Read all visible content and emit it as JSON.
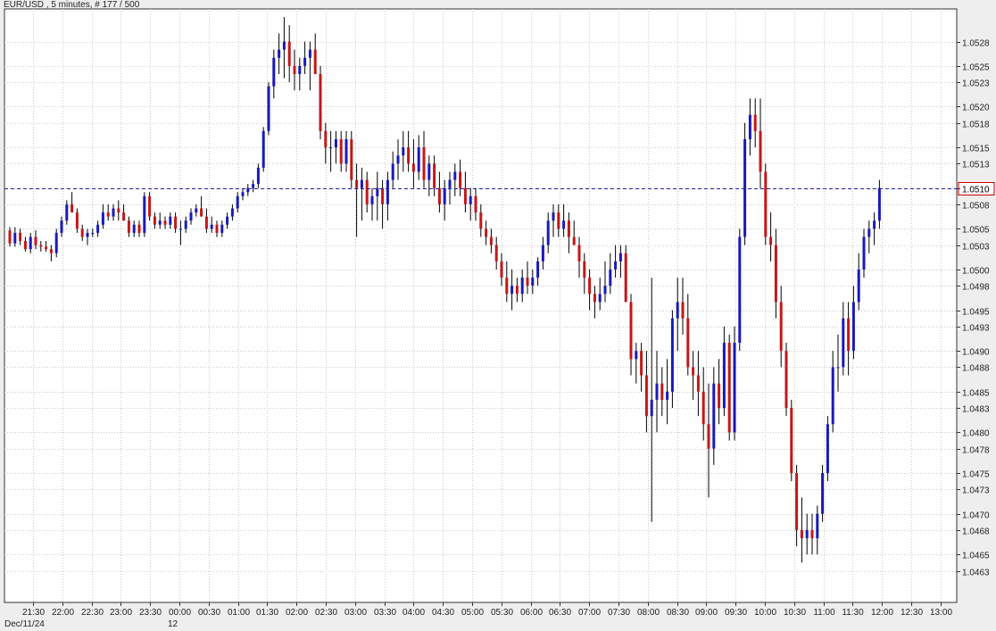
{
  "header": {
    "text": "EUR/USD , 5 minutes, # 177 / 500"
  },
  "chart_data": {
    "type": "candlestick",
    "symbol": "EUR/USD",
    "timeframe": "5 minutes",
    "bar_index": "# 177 / 500",
    "date_label": "Dec/11/24",
    "day_marker": "12",
    "current_price": "1.0510",
    "ylim": [
      1.0463,
      1.0529
    ],
    "y_ticks": [
      "1.0528",
      "1.0525",
      "1.0523",
      "1.0520",
      "1.0518",
      "1.0515",
      "1.0513",
      "1.0510",
      "1.0508",
      "1.0505",
      "1.0503",
      "1.0500",
      "1.0498",
      "1.0495",
      "1.0493",
      "1.0490",
      "1.0488",
      "1.0485",
      "1.0483",
      "1.0480",
      "1.0478",
      "1.0475",
      "1.0473",
      "1.0470",
      "1.0468",
      "1.0465",
      "1.0463"
    ],
    "x_ticks": [
      "21:30",
      "22:00",
      "22:30",
      "23:00",
      "23:30",
      "00:00",
      "00:30",
      "01:00",
      "01:30",
      "02:00",
      "02:30",
      "03:00",
      "03:30",
      "04:00",
      "04:30",
      "05:00",
      "05:30",
      "06:00",
      "06:30",
      "07:00",
      "07:30",
      "08:00",
      "08:30",
      "09:00",
      "09:30",
      "10:00",
      "10:30",
      "11:00",
      "11:30",
      "12:00",
      "12:30",
      "13:00"
    ],
    "colors": {
      "up": "#1a1ab8",
      "down": "#c21818",
      "grid": "#c9c9c9",
      "price_line": "#2020a0",
      "price_box": "#cc0000"
    },
    "candles": [
      [
        1.05048,
        1.05052,
        1.05028,
        1.05032
      ],
      [
        1.05032,
        1.05052,
        1.05028,
        1.05045
      ],
      [
        1.05045,
        1.0505,
        1.0503,
        1.05035
      ],
      [
        1.05035,
        1.0504,
        1.05022,
        1.05025
      ],
      [
        1.05025,
        1.05045,
        1.0502,
        1.0504
      ],
      [
        1.0504,
        1.05048,
        1.05025,
        1.0503
      ],
      [
        1.0503,
        1.05035,
        1.05022,
        1.05028
      ],
      [
        1.05028,
        1.05035,
        1.05022,
        1.05025
      ],
      [
        1.05025,
        1.0503,
        1.0501,
        1.0502
      ],
      [
        1.0502,
        1.0505,
        1.05015,
        1.05045
      ],
      [
        1.05045,
        1.05065,
        1.0504,
        1.0506
      ],
      [
        1.0506,
        1.05085,
        1.05055,
        1.0508
      ],
      [
        1.0508,
        1.05095,
        1.0507,
        1.0507
      ],
      [
        1.0507,
        1.05075,
        1.05045,
        1.0505
      ],
      [
        1.0505,
        1.05055,
        1.05035,
        1.0504
      ],
      [
        1.0504,
        1.0505,
        1.0503,
        1.05045
      ],
      [
        1.05045,
        1.0505,
        1.0504,
        1.05045
      ],
      [
        1.05045,
        1.0506,
        1.0504,
        1.05055
      ],
      [
        1.05055,
        1.0508,
        1.0505,
        1.0507
      ],
      [
        1.0507,
        1.0508,
        1.0506,
        1.05065
      ],
      [
        1.05065,
        1.0508,
        1.0506,
        1.05075
      ],
      [
        1.05075,
        1.05085,
        1.0506,
        1.0507
      ],
      [
        1.0507,
        1.0508,
        1.0506,
        1.0506
      ],
      [
        1.0506,
        1.05065,
        1.0504,
        1.05045
      ],
      [
        1.05045,
        1.0506,
        1.0504,
        1.05055
      ],
      [
        1.05055,
        1.0506,
        1.0504,
        1.05045
      ],
      [
        1.05045,
        1.05095,
        1.0504,
        1.0509
      ],
      [
        1.0509,
        1.05095,
        1.0506,
        1.05065
      ],
      [
        1.05065,
        1.0507,
        1.0505,
        1.05055
      ],
      [
        1.05055,
        1.0507,
        1.0505,
        1.0506
      ],
      [
        1.0506,
        1.05065,
        1.0505,
        1.05055
      ],
      [
        1.05055,
        1.0507,
        1.0505,
        1.05065
      ],
      [
        1.05065,
        1.0507,
        1.05045,
        1.0505
      ],
      [
        1.0505,
        1.0506,
        1.0503,
        1.0505
      ],
      [
        1.0505,
        1.05065,
        1.05045,
        1.0506
      ],
      [
        1.0506,
        1.05075,
        1.05055,
        1.0507
      ],
      [
        1.0507,
        1.0508,
        1.05065,
        1.05075
      ],
      [
        1.05075,
        1.0509,
        1.0507,
        1.05065
      ],
      [
        1.05065,
        1.05075,
        1.05045,
        1.0505
      ],
      [
        1.0505,
        1.05065,
        1.05045,
        1.05055
      ],
      [
        1.05055,
        1.0506,
        1.0504,
        1.05045
      ],
      [
        1.05045,
        1.0506,
        1.0504,
        1.05055
      ],
      [
        1.05055,
        1.0507,
        1.0505,
        1.05065
      ],
      [
        1.05065,
        1.0508,
        1.0506,
        1.05075
      ],
      [
        1.05075,
        1.05095,
        1.0507,
        1.0509
      ],
      [
        1.0509,
        1.051,
        1.05085,
        1.05095
      ],
      [
        1.05095,
        1.05105,
        1.0509,
        1.051
      ],
      [
        1.051,
        1.0511,
        1.05095,
        1.05105
      ],
      [
        1.05105,
        1.0513,
        1.051,
        1.05125
      ],
      [
        1.05125,
        1.05175,
        1.0512,
        1.0517
      ],
      [
        1.0517,
        1.0523,
        1.05165,
        1.05225
      ],
      [
        1.05225,
        1.0527,
        1.0521,
        1.0526
      ],
      [
        1.0526,
        1.0529,
        1.0524,
        1.0527
      ],
      [
        1.0527,
        1.0531,
        1.05235,
        1.0528
      ],
      [
        1.0528,
        1.053,
        1.0523,
        1.0525
      ],
      [
        1.0525,
        1.0527,
        1.0522,
        1.0524
      ],
      [
        1.0524,
        1.0526,
        1.0522,
        1.0525
      ],
      [
        1.0525,
        1.0528,
        1.0524,
        1.0526
      ],
      [
        1.0526,
        1.0528,
        1.0522,
        1.0527
      ],
      [
        1.0527,
        1.0529,
        1.0524,
        1.0524
      ],
      [
        1.0524,
        1.0525,
        1.0516,
        1.0517
      ],
      [
        1.0517,
        1.0518,
        1.0513,
        1.0515
      ],
      [
        1.0515,
        1.0517,
        1.0512,
        1.0515
      ],
      [
        1.0515,
        1.0517,
        1.0513,
        1.0516
      ],
      [
        1.0516,
        1.0517,
        1.0512,
        1.0513
      ],
      [
        1.0513,
        1.0517,
        1.0512,
        1.0516
      ],
      [
        1.0516,
        1.0517,
        1.051,
        1.0511
      ],
      [
        1.0511,
        1.0513,
        1.0504,
        1.051
      ],
      [
        1.051,
        1.05125,
        1.0506,
        1.0511
      ],
      [
        1.0511,
        1.0512,
        1.0507,
        1.0508
      ],
      [
        1.0508,
        1.051,
        1.0506,
        1.0509
      ],
      [
        1.0509,
        1.0512,
        1.0506,
        1.051
      ],
      [
        1.051,
        1.0511,
        1.0505,
        1.0508
      ],
      [
        1.0508,
        1.0512,
        1.0506,
        1.0511
      ],
      [
        1.0511,
        1.05145,
        1.051,
        1.0513
      ],
      [
        1.0513,
        1.0516,
        1.0511,
        1.0514
      ],
      [
        1.0514,
        1.0517,
        1.0512,
        1.0515
      ],
      [
        1.0515,
        1.0517,
        1.0512,
        1.0513
      ],
      [
        1.0513,
        1.0516,
        1.051,
        1.0512
      ],
      [
        1.0512,
        1.05165,
        1.0511,
        1.0515
      ],
      [
        1.0515,
        1.0517,
        1.051,
        1.0511
      ],
      [
        1.0511,
        1.0514,
        1.0509,
        1.0513
      ],
      [
        1.0513,
        1.0514,
        1.0509,
        1.051
      ],
      [
        1.051,
        1.0512,
        1.0507,
        1.0508
      ],
      [
        1.0508,
        1.0511,
        1.0506,
        1.051
      ],
      [
        1.051,
        1.0512,
        1.0508,
        1.0511
      ],
      [
        1.0511,
        1.0513,
        1.0509,
        1.0512
      ],
      [
        1.0512,
        1.05135,
        1.0509,
        1.051
      ],
      [
        1.051,
        1.0512,
        1.0507,
        1.0508
      ],
      [
        1.0508,
        1.051,
        1.0506,
        1.0509
      ],
      [
        1.0509,
        1.051,
        1.0506,
        1.0507
      ],
      [
        1.0507,
        1.0508,
        1.0504,
        1.0505
      ],
      [
        1.0505,
        1.0506,
        1.0503,
        1.0504
      ],
      [
        1.0504,
        1.0505,
        1.0502,
        1.0503
      ],
      [
        1.0503,
        1.0504,
        1.05,
        1.0501
      ],
      [
        1.0501,
        1.0502,
        1.0498,
        1.0499
      ],
      [
        1.0499,
        1.0501,
        1.0496,
        1.0497
      ],
      [
        1.0497,
        1.05,
        1.0495,
        1.0498
      ],
      [
        1.0498,
        1.0499,
        1.0496,
        1.0497
      ],
      [
        1.0497,
        1.05,
        1.0496,
        1.0499
      ],
      [
        1.0499,
        1.0501,
        1.0497,
        1.0498
      ],
      [
        1.0498,
        1.05,
        1.0497,
        1.0499
      ],
      [
        1.0499,
        1.05015,
        1.0498,
        1.0501
      ],
      [
        1.0501,
        1.0504,
        1.05,
        1.0503
      ],
      [
        1.0503,
        1.0507,
        1.0502,
        1.0506
      ],
      [
        1.0506,
        1.0508,
        1.0504,
        1.0507
      ],
      [
        1.0507,
        1.0508,
        1.0504,
        1.0505
      ],
      [
        1.0505,
        1.0508,
        1.0504,
        1.0506
      ],
      [
        1.0506,
        1.0507,
        1.0502,
        1.0504
      ],
      [
        1.0504,
        1.0506,
        1.0503,
        1.0503
      ],
      [
        1.0503,
        1.0504,
        1.0499,
        1.0501
      ],
      [
        1.0501,
        1.0502,
        1.0497,
        1.0499
      ],
      [
        1.0499,
        1.05,
        1.0495,
        1.0497
      ],
      [
        1.0497,
        1.0498,
        1.0494,
        1.0496
      ],
      [
        1.0496,
        1.0499,
        1.0495,
        1.0497
      ],
      [
        1.0497,
        1.0501,
        1.0496,
        1.0498
      ],
      [
        1.0498,
        1.0502,
        1.0497,
        1.05
      ],
      [
        1.05,
        1.0503,
        1.0499,
        1.0501
      ],
      [
        1.0501,
        1.0503,
        1.0499,
        1.0502
      ],
      [
        1.0502,
        1.0503,
        1.0498,
        1.0496
      ],
      [
        1.0496,
        1.0497,
        1.0487,
        1.0489
      ],
      [
        1.0489,
        1.0491,
        1.0486,
        1.049
      ],
      [
        1.049,
        1.0491,
        1.0485,
        1.0487
      ],
      [
        1.0487,
        1.049,
        1.048,
        1.0482
      ],
      [
        1.0482,
        1.0499,
        1.0469,
        1.0484
      ],
      [
        1.0484,
        1.049,
        1.048,
        1.0486
      ],
      [
        1.0486,
        1.0488,
        1.0482,
        1.0484
      ],
      [
        1.0484,
        1.0489,
        1.0481,
        1.0485
      ],
      [
        1.0485,
        1.0495,
        1.0483,
        1.0494
      ],
      [
        1.0494,
        1.0499,
        1.049,
        1.0496
      ],
      [
        1.0496,
        1.0499,
        1.0492,
        1.0494
      ],
      [
        1.0494,
        1.0497,
        1.0487,
        1.0488
      ],
      [
        1.0488,
        1.049,
        1.0484,
        1.0487
      ],
      [
        1.0487,
        1.049,
        1.0482,
        1.0485
      ],
      [
        1.0485,
        1.0488,
        1.0479,
        1.0481
      ],
      [
        1.0481,
        1.0486,
        1.0472,
        1.0478
      ],
      [
        1.0478,
        1.0488,
        1.0476,
        1.0486
      ],
      [
        1.0486,
        1.0489,
        1.0481,
        1.0483
      ],
      [
        1.0483,
        1.0493,
        1.0482,
        1.0491
      ],
      [
        1.0491,
        1.0492,
        1.0479,
        1.048
      ],
      [
        1.048,
        1.0493,
        1.0479,
        1.0491
      ],
      [
        1.0491,
        1.0505,
        1.049,
        1.0504
      ],
      [
        1.0504,
        1.0518,
        1.0503,
        1.0516
      ],
      [
        1.0516,
        1.0521,
        1.0514,
        1.0519
      ],
      [
        1.0519,
        1.0521,
        1.0515,
        1.0517
      ],
      [
        1.0517,
        1.0521,
        1.051,
        1.0512
      ],
      [
        1.0512,
        1.0513,
        1.0503,
        1.0504
      ],
      [
        1.0504,
        1.0507,
        1.0501,
        1.0503
      ],
      [
        1.0503,
        1.0505,
        1.0494,
        1.0496
      ],
      [
        1.0496,
        1.0498,
        1.0488,
        1.049
      ],
      [
        1.049,
        1.0491,
        1.0482,
        1.0483
      ],
      [
        1.0483,
        1.0484,
        1.0474,
        1.0475
      ],
      [
        1.0475,
        1.0476,
        1.0466,
        1.0468
      ],
      [
        1.0468,
        1.0472,
        1.0464,
        1.0467
      ],
      [
        1.0467,
        1.047,
        1.0465,
        1.0468
      ],
      [
        1.0468,
        1.047,
        1.0465,
        1.0467
      ],
      [
        1.0467,
        1.0471,
        1.0465,
        1.047
      ],
      [
        1.047,
        1.0476,
        1.0469,
        1.0475
      ],
      [
        1.0475,
        1.0482,
        1.0474,
        1.0481
      ],
      [
        1.0481,
        1.049,
        1.048,
        1.0488
      ],
      [
        1.0488,
        1.0492,
        1.0485,
        1.0488
      ],
      [
        1.0488,
        1.0496,
        1.0487,
        1.0494
      ],
      [
        1.0494,
        1.0496,
        1.0487,
        1.049
      ],
      [
        1.049,
        1.0498,
        1.0489,
        1.0496
      ],
      [
        1.0496,
        1.0502,
        1.0495,
        1.05
      ],
      [
        1.05,
        1.0505,
        1.0499,
        1.0504
      ],
      [
        1.0504,
        1.0506,
        1.0502,
        1.0505
      ],
      [
        1.0505,
        1.0507,
        1.0503,
        1.0506
      ],
      [
        1.0506,
        1.0511,
        1.0505,
        1.051
      ]
    ]
  }
}
